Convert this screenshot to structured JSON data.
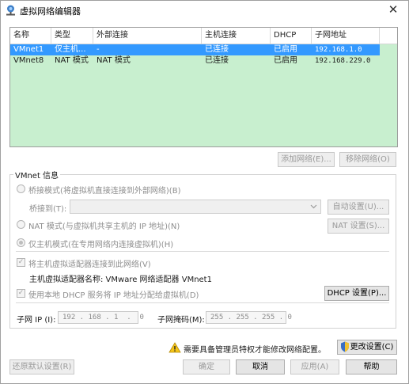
{
  "window": {
    "title": "虚拟网络编辑器",
    "close_glyph": "✕"
  },
  "table": {
    "headers": [
      "名称",
      "类型",
      "外部连接",
      "主机连接",
      "DHCP",
      "子网地址"
    ],
    "rows": [
      {
        "name": "VMnet1",
        "type": "仅主机...",
        "external": "-",
        "host": "已连接",
        "dhcp": "已启用",
        "subnet": "192.168.1.0",
        "selected": true
      },
      {
        "name": "VMnet8",
        "type": "NAT 模式",
        "external": "NAT 模式",
        "host": "已连接",
        "dhcp": "已启用",
        "subnet": "192.168.229.0",
        "selected": false
      }
    ]
  },
  "table_buttons": {
    "add": "添加网络(E)...",
    "remove": "移除网络(O)"
  },
  "vmnet_info": {
    "legend": "VMnet 信息",
    "bridged_label": "桥接模式(将虚拟机直接连接到外部网络)(B)",
    "bridged_to_label": "桥接到(T):",
    "bridged_to_value": "",
    "auto_settings": "自动设置(U)...",
    "nat_label": "NAT 模式(与虚拟机共享主机的 IP 地址)(N)",
    "nat_settings": "NAT 设置(S)...",
    "hostonly_label": "仅主机模式(在专用网络内连接虚拟机)(H)",
    "connect_adapter_label": "将主机虚拟适配器连接到此网络(V)",
    "adapter_name_label": "主机虚拟适配器名称: VMware 网络适配器 VMnet1",
    "dhcp_label": "使用本地 DHCP 服务将 IP 地址分配给虚拟机(D)",
    "dhcp_settings": "DHCP 设置(P)...",
    "subnet_ip_label": "子网 IP (I):",
    "subnet_ip_value": "192 . 168 . 1  .  0",
    "subnet_mask_label": "子网掩码(M):",
    "subnet_mask_value": "255 . 255 . 255 . 0",
    "check_glyph": "✓"
  },
  "admin_notice": {
    "text": "需要具备管理员特权才能修改网络配置。",
    "change_settings": "更改设置(C)"
  },
  "footer": {
    "restore": "还原默认设置(R)",
    "ok": "确定",
    "cancel": "取消",
    "apply": "应用(A)",
    "help": "帮助"
  }
}
